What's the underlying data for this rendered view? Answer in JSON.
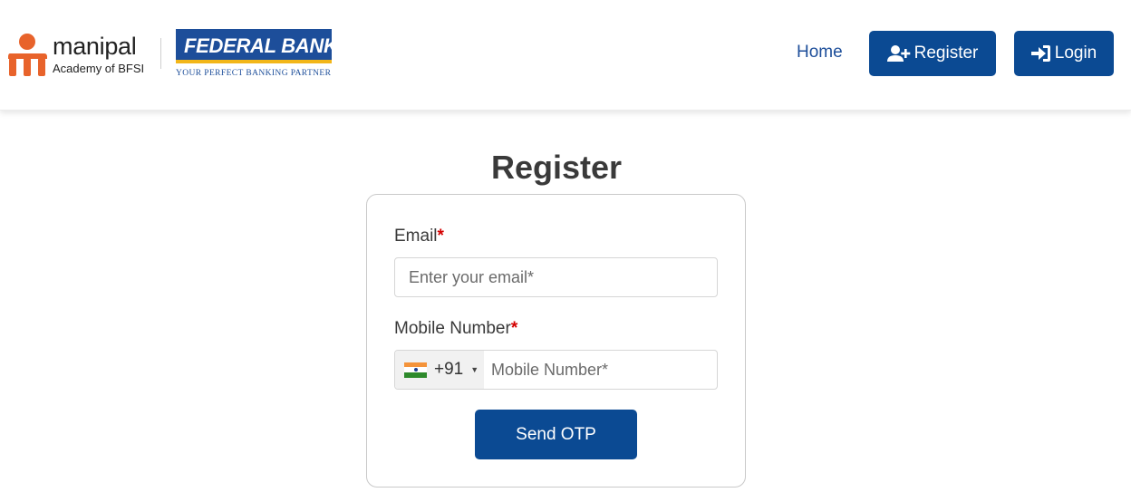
{
  "brand": {
    "manipal_name": "manipal",
    "manipal_sub": "Academy of BFSI",
    "bank_name": "FEDERAL BANK",
    "bank_tagline": "YOUR PERFECT BANKING PARTNER"
  },
  "nav": {
    "home": "Home",
    "register": "Register",
    "login": "Login"
  },
  "page": {
    "title": "Register"
  },
  "form": {
    "email_label": "Email",
    "email_placeholder": "Enter your email*",
    "mobile_label": "Mobile Number",
    "mobile_placeholder": "Mobile Number*",
    "country_code": "+91",
    "required_mark": "*",
    "send_otp": "Send OTP"
  },
  "icons": {
    "register": "user-plus-icon",
    "login": "sign-in-icon",
    "flag": "india-flag-icon",
    "caret": "chevron-down-icon"
  },
  "colors": {
    "primary": "#0b4a93",
    "link": "#1d4e9a",
    "required": "#d40000",
    "manipal_orange": "#e8632b",
    "bank_gold": "#f2b619"
  }
}
